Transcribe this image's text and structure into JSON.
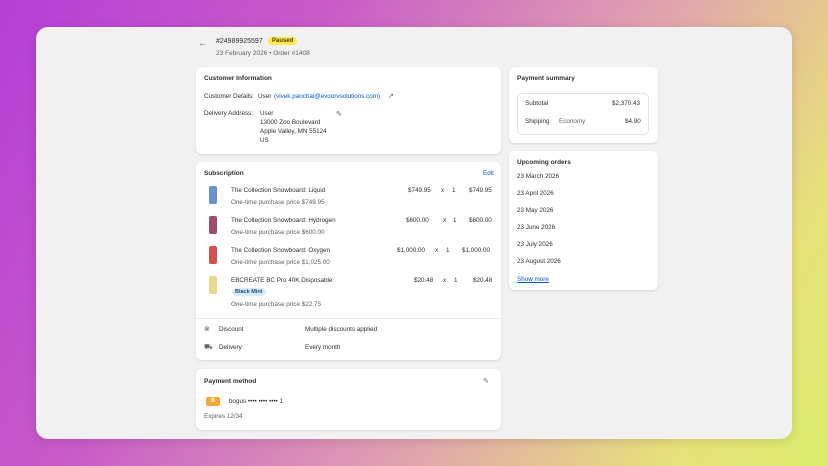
{
  "header": {
    "order_id": "#24989925597",
    "status": "Paused",
    "subline": "23 February 2026 • Order #1408"
  },
  "customer": {
    "title": "Customer Information",
    "details_label": "Customer Details:",
    "details_name": "User",
    "details_email": "(vivek.panchal@evoorvsolutions.com)",
    "address_label": "Delivery Address:",
    "address_lines": [
      "User",
      "13000 Zoo Boulevard",
      "Apple Valley, MN 55124",
      "US"
    ]
  },
  "subscription": {
    "title": "Subscription",
    "edit_label": "Edit",
    "items": [
      {
        "name": "The Collection Snowboard: Liquid",
        "price": "$749.95",
        "times": "x",
        "qty": "1",
        "total": "$749.95",
        "note": "One-time purchase price $749.95",
        "thumb": "#6b8fcc"
      },
      {
        "name": "The Collection Snowboard: Hydrogen",
        "price": "$600.00",
        "times": "x",
        "qty": "1",
        "total": "$600.00",
        "note": "One-time purchase price $600.00",
        "thumb": "#a44a6a"
      },
      {
        "name": "The Collection Snowboard: Oxygen",
        "price": "$1,000.00",
        "times": "x",
        "qty": "1",
        "total": "$1,000.00",
        "note": "One-time purchase price $1,025.00",
        "thumb": "#d25050"
      },
      {
        "name": "EBCREATE BC Pro 40K Disposable",
        "price": "$20.48",
        "times": "x",
        "qty": "1",
        "total": "$20.48",
        "note": "One-time purchase price $22.75",
        "variant": "Black Mint",
        "thumb": "#e9d98a"
      }
    ],
    "discount_label": "Discount",
    "discount_value": "Multiple discounts applied",
    "delivery_label": "Delivery",
    "delivery_value": "Every month"
  },
  "payment_method": {
    "title": "Payment method",
    "badge": "B",
    "card": "bogus •••• •••• •••• 1",
    "expires": "Expires 12/34"
  },
  "payment_summary": {
    "title": "Payment summary",
    "subtotal_label": "Subtotal",
    "subtotal_value": "$2,370.43",
    "shipping_label": "Shipping",
    "shipping_method": "Economy",
    "shipping_value": "$4.90"
  },
  "upcoming": {
    "title": "Upcoming orders",
    "dates": [
      "23 March 2026",
      "23 April 2026",
      "23 May 2026",
      "23 June 2026",
      "23 July 2026",
      "23 August 2026"
    ],
    "show_more": "Show more"
  },
  "colors": {
    "badge_paused": "#ffe94d",
    "link": "#005bd3",
    "payment_badge": "#f3a73b"
  }
}
